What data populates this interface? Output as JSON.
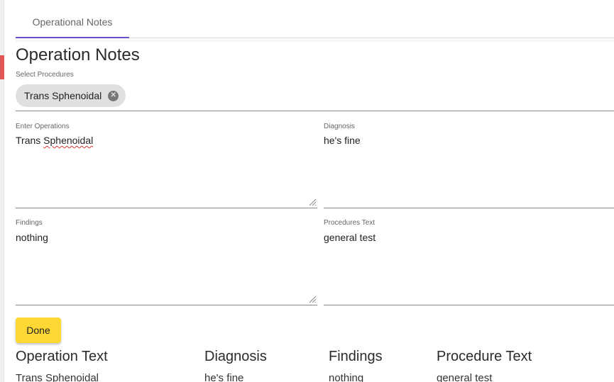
{
  "tabs": [
    {
      "label": "Operational Notes"
    }
  ],
  "page": {
    "title": "Operation Notes"
  },
  "procedures": {
    "label": "Select Procedures",
    "chips": [
      {
        "label": "Trans Sphenoidal"
      }
    ]
  },
  "form": {
    "operations": {
      "label": "Enter Operations",
      "value_parts": [
        "Trans ",
        "Sphenoidal"
      ]
    },
    "diagnosis": {
      "label": "Diagnosis",
      "value": "he's fine"
    },
    "findings": {
      "label": "Findings",
      "value": "nothing"
    },
    "procedures_text": {
      "label": "Procedures Text",
      "value": "general test"
    }
  },
  "actions": {
    "done_label": "Done"
  },
  "summary": {
    "operation_text": {
      "heading": "Operation Text",
      "value": "Trans Sphenoidal"
    },
    "diagnosis": {
      "heading": "Diagnosis",
      "value": "he's fine"
    },
    "findings": {
      "heading": "Findings",
      "value": "nothing"
    },
    "procedure_text": {
      "heading": "Procedure Text",
      "value": "general test"
    }
  },
  "colors": {
    "tab_indicator": "#6a4fc8",
    "done_button": "#fdd835",
    "side_marker": "#e05555"
  },
  "icons": {
    "chip_remove": "cancel-circle-icon",
    "resize": "resize-handle-icon"
  }
}
